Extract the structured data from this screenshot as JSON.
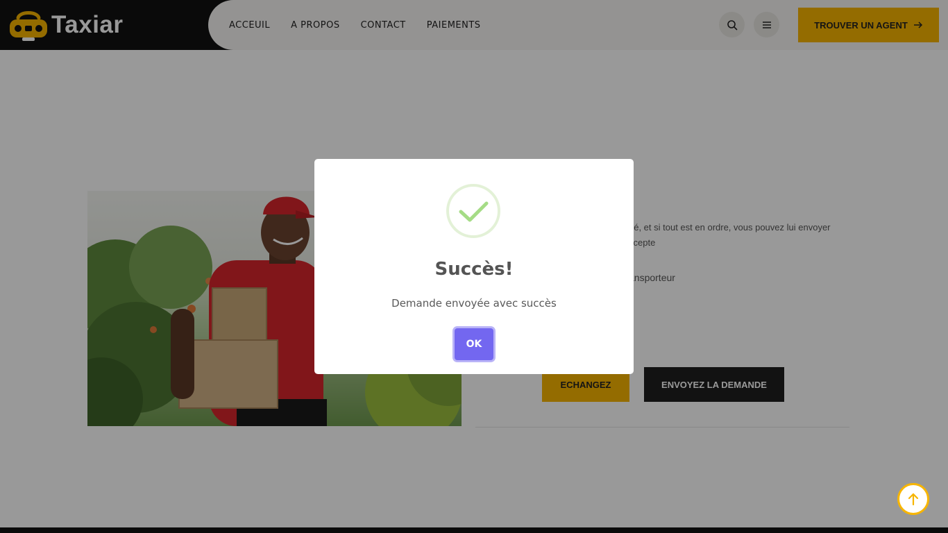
{
  "brand": {
    "name": "Taxiar",
    "color": "#f7b500"
  },
  "nav": {
    "items": [
      {
        "label": "ACCEUIL"
      },
      {
        "label": "A PROPOS"
      },
      {
        "label": "CONTACT"
      },
      {
        "label": "PAIEMENTS"
      }
    ]
  },
  "header": {
    "search_icon": "search-icon",
    "menu_icon": "menu-icon",
    "cta_label": "TROUVER UN AGENT"
  },
  "content": {
    "text_line1": "oé, et si tout est en ordre, vous pouvez lui envoyer",
    "text_line2": "ccepte",
    "text_line3": "ansporteur",
    "echangez_label": "ECHANGEZ",
    "envoyez_label": "ENVOYEZ LA DEMANDE"
  },
  "modal": {
    "title": "Succès!",
    "message": "Demande envoyée avec succès",
    "ok_label": "OK",
    "accent": "#7367f0",
    "icon": "success-check-icon"
  },
  "scroll_top": {
    "icon": "arrow-up-icon"
  }
}
